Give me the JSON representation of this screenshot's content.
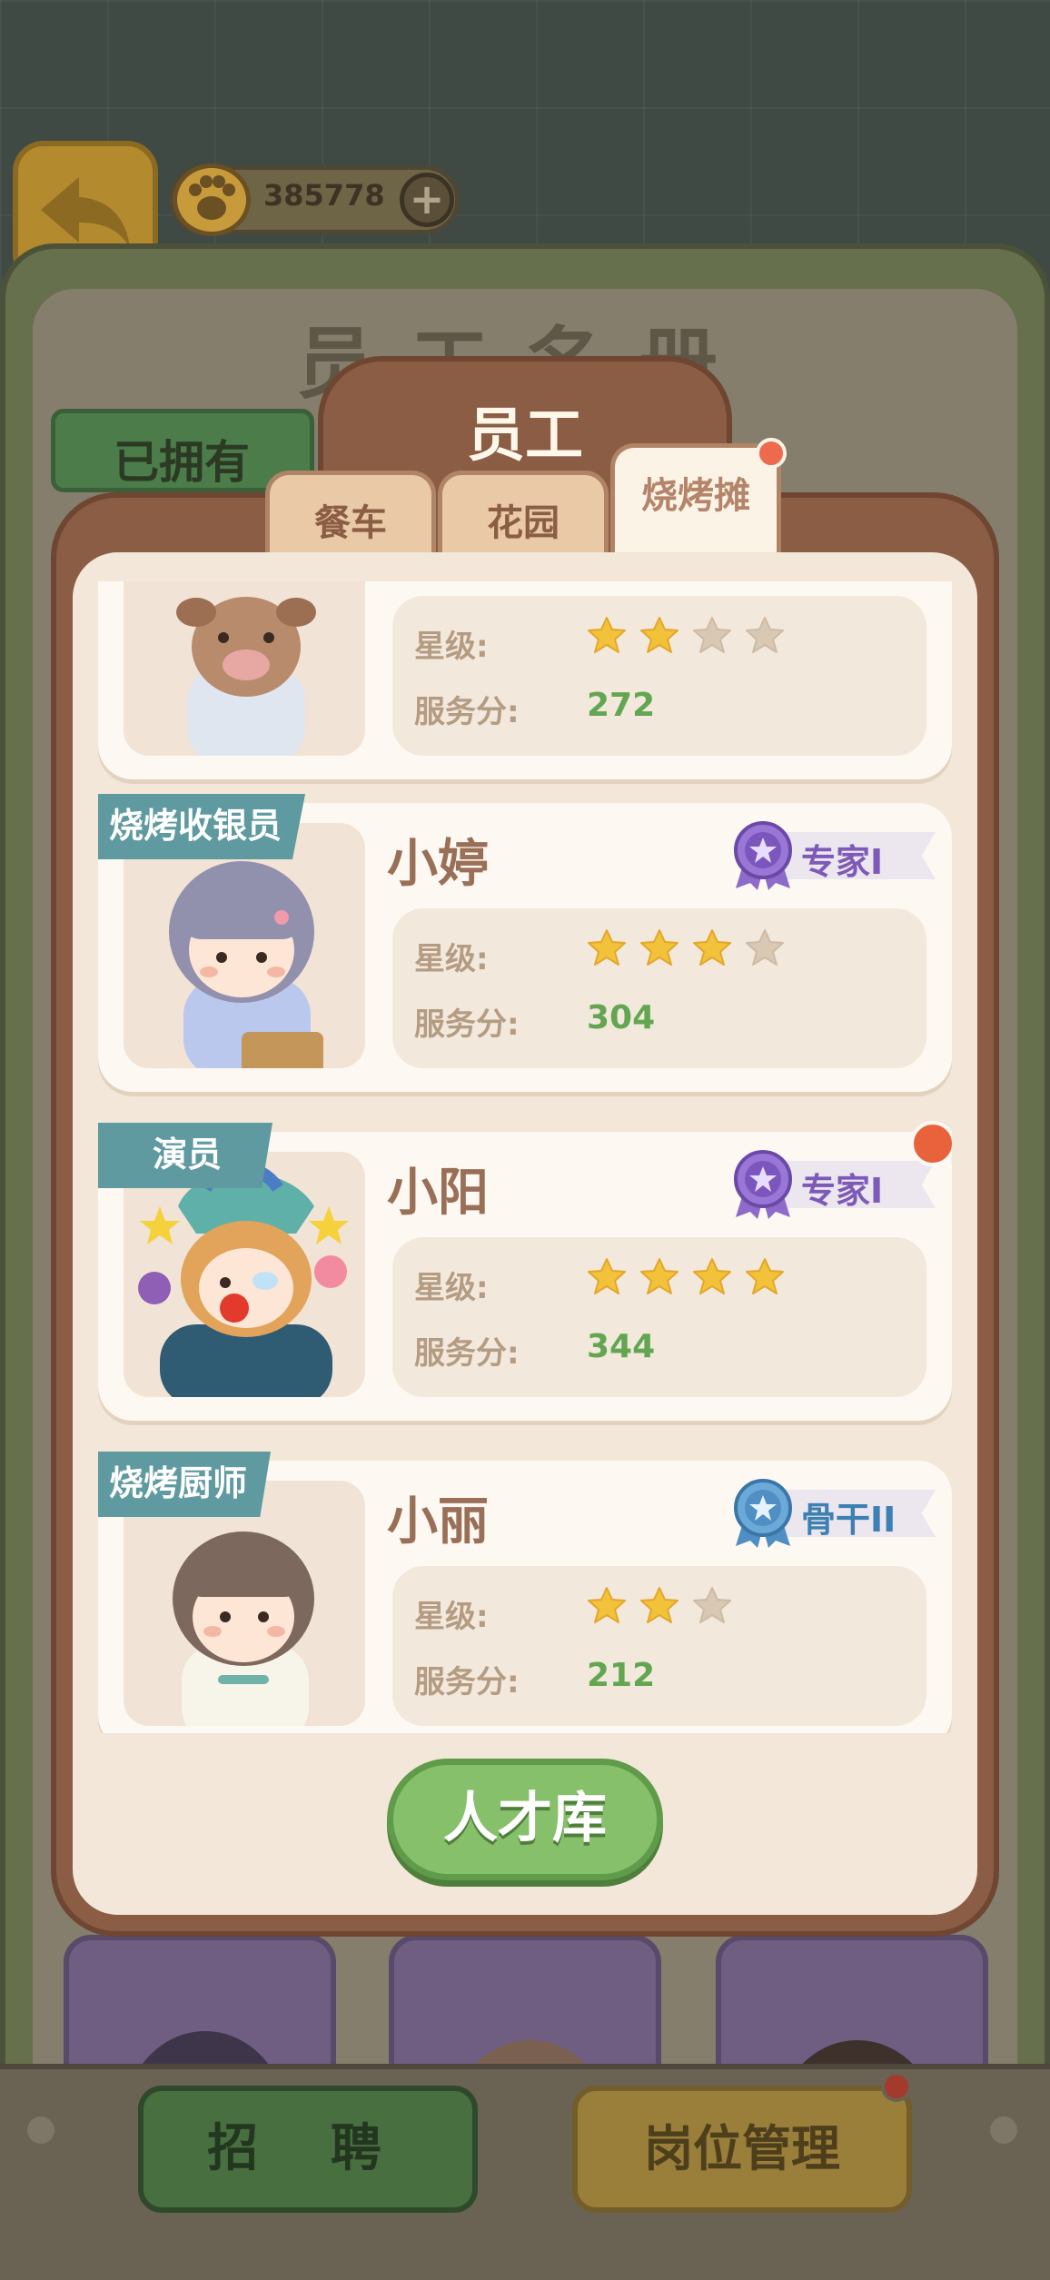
{
  "currency": {
    "value": "385778",
    "plus_label": "+"
  },
  "background": {
    "title": "员工名册",
    "owned_tab": "已拥有"
  },
  "modal": {
    "title": "员工",
    "tabs": [
      {
        "label": "餐车"
      },
      {
        "label": "花园"
      },
      {
        "label": "烧烤摊"
      }
    ]
  },
  "labels": {
    "star": "星级:",
    "score": "服务分:"
  },
  "employees": [
    {
      "role": "",
      "name": "",
      "stars": 2,
      "max_stars": 4,
      "score": "272",
      "badge": ""
    },
    {
      "role": "烧烤收银员",
      "name": "小婷",
      "stars": 3,
      "max_stars": 4,
      "score": "304",
      "badge": "专家I"
    },
    {
      "role": "演员",
      "name": "小阳",
      "stars": 4,
      "max_stars": 4,
      "score": "344",
      "badge": "专家I"
    },
    {
      "role": "烧烤厨师",
      "name": "小丽",
      "stars": 2,
      "max_stars": 3,
      "score": "212",
      "badge": "骨干II"
    }
  ],
  "talent_button": "人才库",
  "bottom": {
    "recruit": "招 聘",
    "positions": "岗位管理"
  },
  "colors": {
    "star_on": "#f2c23a",
    "star_off": "#d9c8b4",
    "score_green": "#63a652",
    "accent_brown": "#8a5d44"
  }
}
